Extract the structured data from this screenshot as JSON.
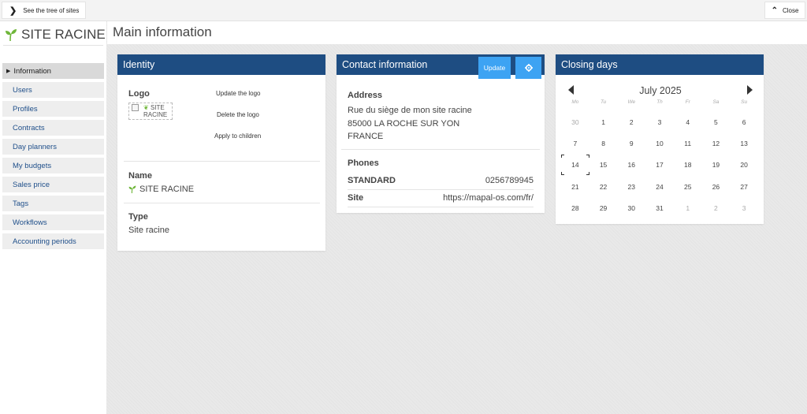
{
  "topbar": {
    "tree_label": "See the tree of sites",
    "close_label": "Close"
  },
  "site": {
    "title": "SITE RACINE"
  },
  "page": {
    "title": "Main information"
  },
  "sidebar": {
    "items": [
      {
        "label": "Information",
        "active": true
      },
      {
        "label": "Users"
      },
      {
        "label": "Profiles"
      },
      {
        "label": "Contracts"
      },
      {
        "label": "Day planners"
      },
      {
        "label": "My budgets"
      },
      {
        "label": "Sales price"
      },
      {
        "label": "Tags"
      },
      {
        "label": "Workflows"
      },
      {
        "label": "Accounting periods"
      }
    ]
  },
  "identity": {
    "header": "Identity",
    "logo_label": "Logo",
    "logo_alt_line1": "SITE",
    "logo_alt_line2": "RACINE",
    "update_logo": "Update the logo",
    "delete_logo": "Delete the logo",
    "apply_children": "Apply to children",
    "name_label": "Name",
    "name_value": "SITE RACINE",
    "type_label": "Type",
    "type_value": "Site racine"
  },
  "contact": {
    "header": "Contact information",
    "update_label": "Update",
    "address_label": "Address",
    "address_lines": [
      "Rue du siège de mon site racine",
      "85000 LA ROCHE SUR YON",
      "FRANCE"
    ],
    "phones_label": "Phones",
    "phones": [
      {
        "key": "STANDARD",
        "value": "0256789945"
      },
      {
        "key": "Site",
        "value": "https://mapal-os.com/fr/"
      }
    ]
  },
  "closing": {
    "header": "Closing days",
    "month": "July 2025",
    "weekdays": [
      "Mo",
      "Tu",
      "We",
      "Th",
      "Fr",
      "Sa",
      "Su"
    ],
    "today": 14,
    "days": [
      {
        "d": "30",
        "other": true
      },
      {
        "d": "1"
      },
      {
        "d": "2"
      },
      {
        "d": "3"
      },
      {
        "d": "4"
      },
      {
        "d": "5"
      },
      {
        "d": "6"
      },
      {
        "d": "7"
      },
      {
        "d": "8"
      },
      {
        "d": "9"
      },
      {
        "d": "10"
      },
      {
        "d": "11"
      },
      {
        "d": "12"
      },
      {
        "d": "13"
      },
      {
        "d": "14",
        "today": true
      },
      {
        "d": "15"
      },
      {
        "d": "16"
      },
      {
        "d": "17"
      },
      {
        "d": "18"
      },
      {
        "d": "19"
      },
      {
        "d": "20"
      },
      {
        "d": "21"
      },
      {
        "d": "22"
      },
      {
        "d": "23"
      },
      {
        "d": "24"
      },
      {
        "d": "25"
      },
      {
        "d": "26"
      },
      {
        "d": "27"
      },
      {
        "d": "28"
      },
      {
        "d": "29"
      },
      {
        "d": "30"
      },
      {
        "d": "31"
      },
      {
        "d": "1",
        "other": true
      },
      {
        "d": "2",
        "other": true
      },
      {
        "d": "3",
        "other": true
      }
    ]
  },
  "colors": {
    "header_blue": "#1e4d82",
    "button_blue": "#3da3f3",
    "link_blue": "#1f4f8a",
    "sprout_green": "#6fb63a"
  },
  "icons": {
    "tree": "chevron-right-icon",
    "close": "chevron-up-icon",
    "sprout": "sprout-icon",
    "gear": "gear-icon",
    "prev": "triangle-left-icon",
    "next": "triangle-right-icon"
  }
}
